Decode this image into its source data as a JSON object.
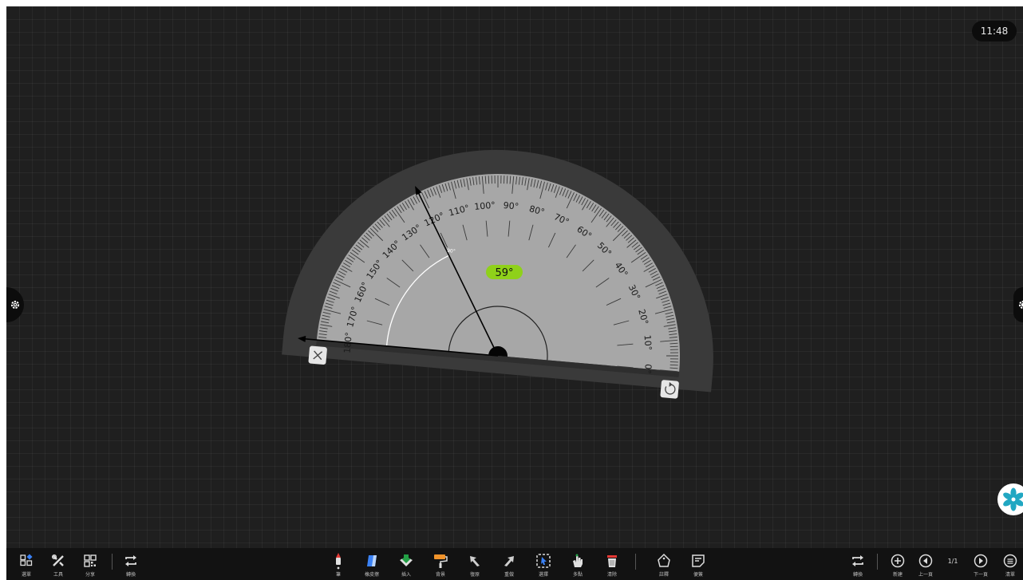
{
  "clock": "11:48",
  "protractor": {
    "measured_angle": "59°",
    "arc_marker": "90°",
    "tick_labels": [
      "0°",
      "10°",
      "20°",
      "30°",
      "40°",
      "50°",
      "60°",
      "70°",
      "80°",
      "90°",
      "100°",
      "110°",
      "120°",
      "130°",
      "140°",
      "150°",
      "160°",
      "170°",
      "180°"
    ],
    "close_icon": "close-icon",
    "reset_icon": "rotate-reset-icon"
  },
  "toolbar": {
    "left": [
      {
        "name": "menu",
        "label": "選單",
        "icon": "apps-icon"
      },
      {
        "name": "tools",
        "label": "工具",
        "icon": "tools-icon"
      },
      {
        "name": "share",
        "label": "分享",
        "icon": "qr-code-icon"
      },
      {
        "name": "switch-left",
        "label": "轉換",
        "icon": "swap-icon"
      }
    ],
    "center": [
      {
        "name": "pen",
        "label": "筆",
        "icon": "pen-icon"
      },
      {
        "name": "eraser",
        "label": "橡皮擦",
        "icon": "eraser-icon"
      },
      {
        "name": "insert",
        "label": "插入",
        "icon": "insert-icon"
      },
      {
        "name": "background",
        "label": "背景",
        "icon": "paint-roller-icon"
      },
      {
        "name": "undo",
        "label": "復原",
        "icon": "undo-arrow-icon"
      },
      {
        "name": "redo",
        "label": "重做",
        "icon": "redo-arrow-icon"
      },
      {
        "name": "select",
        "label": "選擇",
        "icon": "select-icon"
      },
      {
        "name": "multi-touch",
        "label": "多點",
        "icon": "multi-touch-icon"
      },
      {
        "name": "clear",
        "label": "清除",
        "icon": "trash-icon"
      },
      {
        "name": "annotate",
        "label": "註釋",
        "icon": "tag-icon"
      },
      {
        "name": "sticky-note",
        "label": "便簽",
        "icon": "note-icon"
      }
    ],
    "right": [
      {
        "name": "switch-right",
        "label": "轉換",
        "icon": "swap-icon"
      },
      {
        "name": "new",
        "label": "新建",
        "icon": "plus-circle-icon"
      },
      {
        "name": "prev",
        "label": "上一頁",
        "icon": "prev-circle-icon"
      },
      {
        "name": "next",
        "label": "下一頁",
        "icon": "next-circle-icon"
      },
      {
        "name": "list",
        "label": "清單",
        "icon": "list-circle-icon"
      }
    ],
    "page_indicator": "1/1"
  },
  "colors": {
    "board": "#1f1f1f",
    "protractor_outer": "#3a3a3a",
    "protractor_face": "#a7a7a7",
    "angle_badge": "#8fd11a",
    "fab_accent": "#21a7c2"
  }
}
